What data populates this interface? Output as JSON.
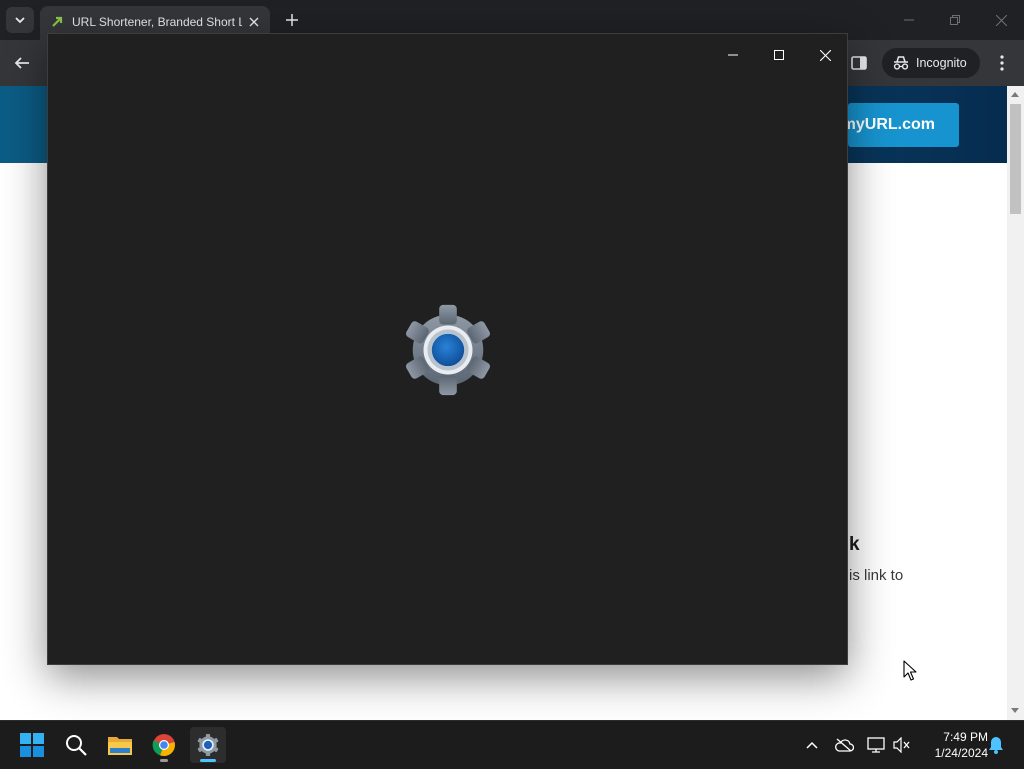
{
  "browser": {
    "tab_title": "URL Shortener, Branded Short L",
    "incognito_label": "Incognito"
  },
  "page": {
    "cta_button": "myURL.com",
    "heading_fragment": "k",
    "text_fragment": "is link to"
  },
  "settings_window": {
    "state": "loading",
    "splash_icon": "gear-icon",
    "accent": "#1a63b8"
  },
  "taskbar": {
    "apps": [
      "start-icon",
      "search-icon",
      "file-explorer-icon",
      "chrome-icon",
      "settings-icon"
    ],
    "time": "7:49 PM",
    "date": "1/24/2024"
  }
}
